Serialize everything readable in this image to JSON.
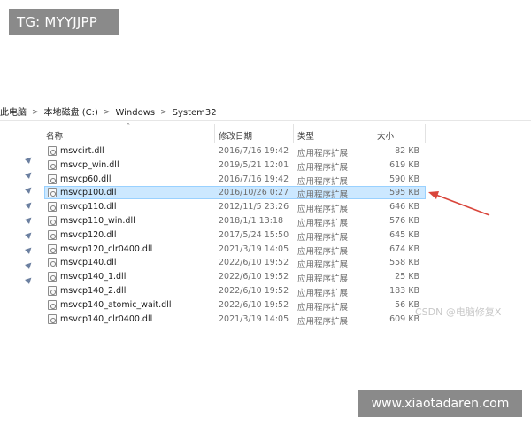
{
  "overlay": {
    "tg_label": "TG: MYYJJPP",
    "watermark_csdn": "CSDN @电脑修复X",
    "site_label": "www.xiaotadaren.com"
  },
  "breadcrumb": [
    "此电脑",
    "本地磁盘 (C:)",
    "Windows",
    "System32"
  ],
  "columns": {
    "name": "名称",
    "modified": "修改日期",
    "type": "类型",
    "size": "大小"
  },
  "files": [
    {
      "name": "msvcirt.dll",
      "modified": "2016/7/16 19:42",
      "type": "应用程序扩展",
      "size": "82 KB"
    },
    {
      "name": "msvcp_win.dll",
      "modified": "2019/5/21 12:01",
      "type": "应用程序扩展",
      "size": "619 KB"
    },
    {
      "name": "msvcp60.dll",
      "modified": "2016/7/16 19:42",
      "type": "应用程序扩展",
      "size": "590 KB"
    },
    {
      "name": "msvcp100.dll",
      "modified": "2016/10/26 0:27",
      "type": "应用程序扩展",
      "size": "595 KB"
    },
    {
      "name": "msvcp110.dll",
      "modified": "2012/11/5 23:26",
      "type": "应用程序扩展",
      "size": "646 KB"
    },
    {
      "name": "msvcp110_win.dll",
      "modified": "2018/1/1 13:18",
      "type": "应用程序扩展",
      "size": "576 KB"
    },
    {
      "name": "msvcp120.dll",
      "modified": "2017/5/24 15:50",
      "type": "应用程序扩展",
      "size": "645 KB"
    },
    {
      "name": "msvcp120_clr0400.dll",
      "modified": "2021/3/19 14:05",
      "type": "应用程序扩展",
      "size": "674 KB"
    },
    {
      "name": "msvcp140.dll",
      "modified": "2022/6/10 19:52",
      "type": "应用程序扩展",
      "size": "558 KB"
    },
    {
      "name": "msvcp140_1.dll",
      "modified": "2022/6/10 19:52",
      "type": "应用程序扩展",
      "size": "25 KB"
    },
    {
      "name": "msvcp140_2.dll",
      "modified": "2022/6/10 19:52",
      "type": "应用程序扩展",
      "size": "183 KB"
    },
    {
      "name": "msvcp140_atomic_wait.dll",
      "modified": "2022/6/10 19:52",
      "type": "应用程序扩展",
      "size": "56 KB"
    },
    {
      "name": "msvcp140_clr0400.dll",
      "modified": "2021/3/19 14:05",
      "type": "应用程序扩展",
      "size": "609 KB"
    }
  ],
  "selected_file": "msvcp100.dll",
  "colors": {
    "selection_fill": "#cce8ff",
    "selection_border": "#99d1ff",
    "arrow": "#d9453b",
    "badge_bg": "#8a8a8a"
  },
  "icons": {
    "file": "dll-file-icon",
    "pin": "pin-icon",
    "sort": "sort-ascending-icon",
    "breadcrumb_separator": "chevron-right-icon"
  }
}
